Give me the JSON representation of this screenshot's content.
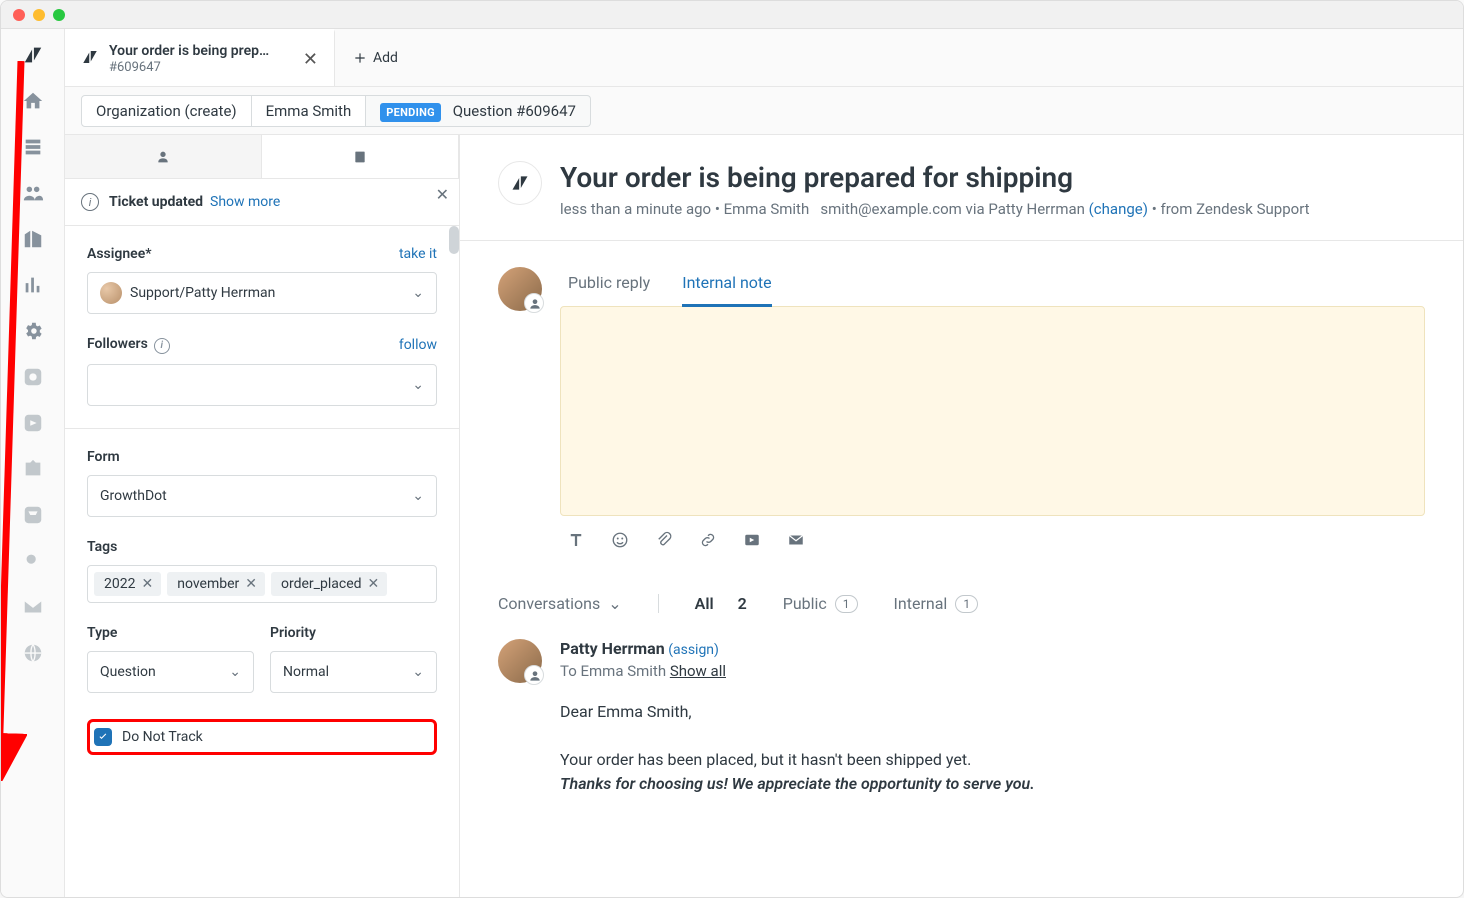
{
  "tab": {
    "title": "Your order is being prep…",
    "sub": "#609647",
    "add": "Add"
  },
  "breadcrumbs": {
    "org": "Organization (create)",
    "requester": "Emma Smith",
    "status": "PENDING",
    "ticket": "Question #609647"
  },
  "notice": {
    "title": "Ticket updated",
    "action": "Show more"
  },
  "form": {
    "assignee": {
      "label": "Assignee*",
      "action": "take it",
      "value": "Support/Patty Herrman"
    },
    "followers": {
      "label": "Followers",
      "action": "follow"
    },
    "form": {
      "label": "Form",
      "value": "GrowthDot"
    },
    "tags": {
      "label": "Tags",
      "items": [
        "2022",
        "november",
        "order_placed"
      ]
    },
    "type": {
      "label": "Type",
      "value": "Question"
    },
    "priority": {
      "label": "Priority",
      "value": "Normal"
    },
    "checkbox": {
      "label": "Do Not Track"
    }
  },
  "header": {
    "title": "Your order is being prepared for shipping",
    "time": "less than a minute ago",
    "requester": "Emma Smith",
    "email": "smith@example.com",
    "via": "via Patty Herrman",
    "change": "(change)",
    "from": "from Zendesk Support"
  },
  "reply": {
    "public": "Public reply",
    "internal": "Internal note"
  },
  "filter": {
    "label": "Conversations",
    "all": "All",
    "all_count": "2",
    "public": "Public",
    "public_count": "1",
    "internal": "Internal",
    "internal_count": "1"
  },
  "message": {
    "from": "Patty Herrman",
    "assign": "(assign)",
    "to": "To Emma Smith",
    "showall": "Show all",
    "line1": "Dear Emma Smith,",
    "line2": "Your order has been placed, but it hasn't been shipped yet.",
    "line3": "Thanks for choosing us! We appreciate the opportunity to serve you."
  }
}
